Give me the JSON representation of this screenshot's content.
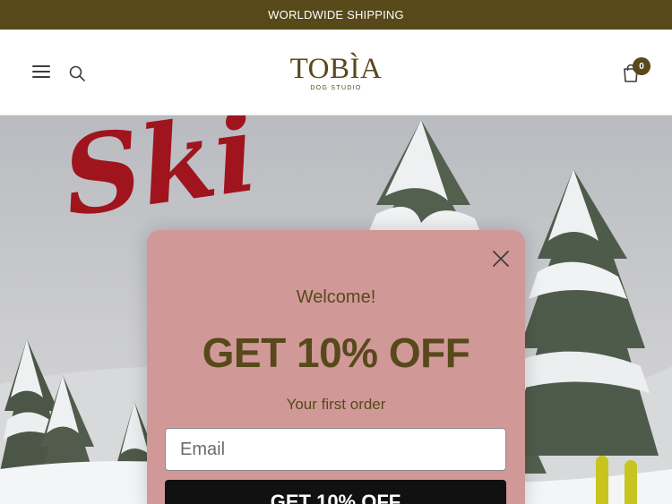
{
  "announcement": {
    "text": "WORLDWIDE SHIPPING"
  },
  "header": {
    "logo_word": "TOBÌA",
    "logo_sub": "DOG STUDIO",
    "cart_count": "0",
    "icons": {
      "menu": "hamburger-menu-icon",
      "search": "search-icon",
      "cart": "shopping-bag-icon"
    }
  },
  "hero": {
    "script_text": "Ski"
  },
  "popup": {
    "welcome": "Welcome!",
    "offer": "GET 10% OFF",
    "subline": "Your first order",
    "email_placeholder": "Email",
    "submit_label": "GET 10% OFF",
    "close_icon": "close-icon"
  },
  "colors": {
    "brand": "#57491a",
    "popup_bg": "#d09998",
    "button_bg": "#111111",
    "script_red": "#a0141e",
    "accent_yellow": "#c7c420"
  }
}
